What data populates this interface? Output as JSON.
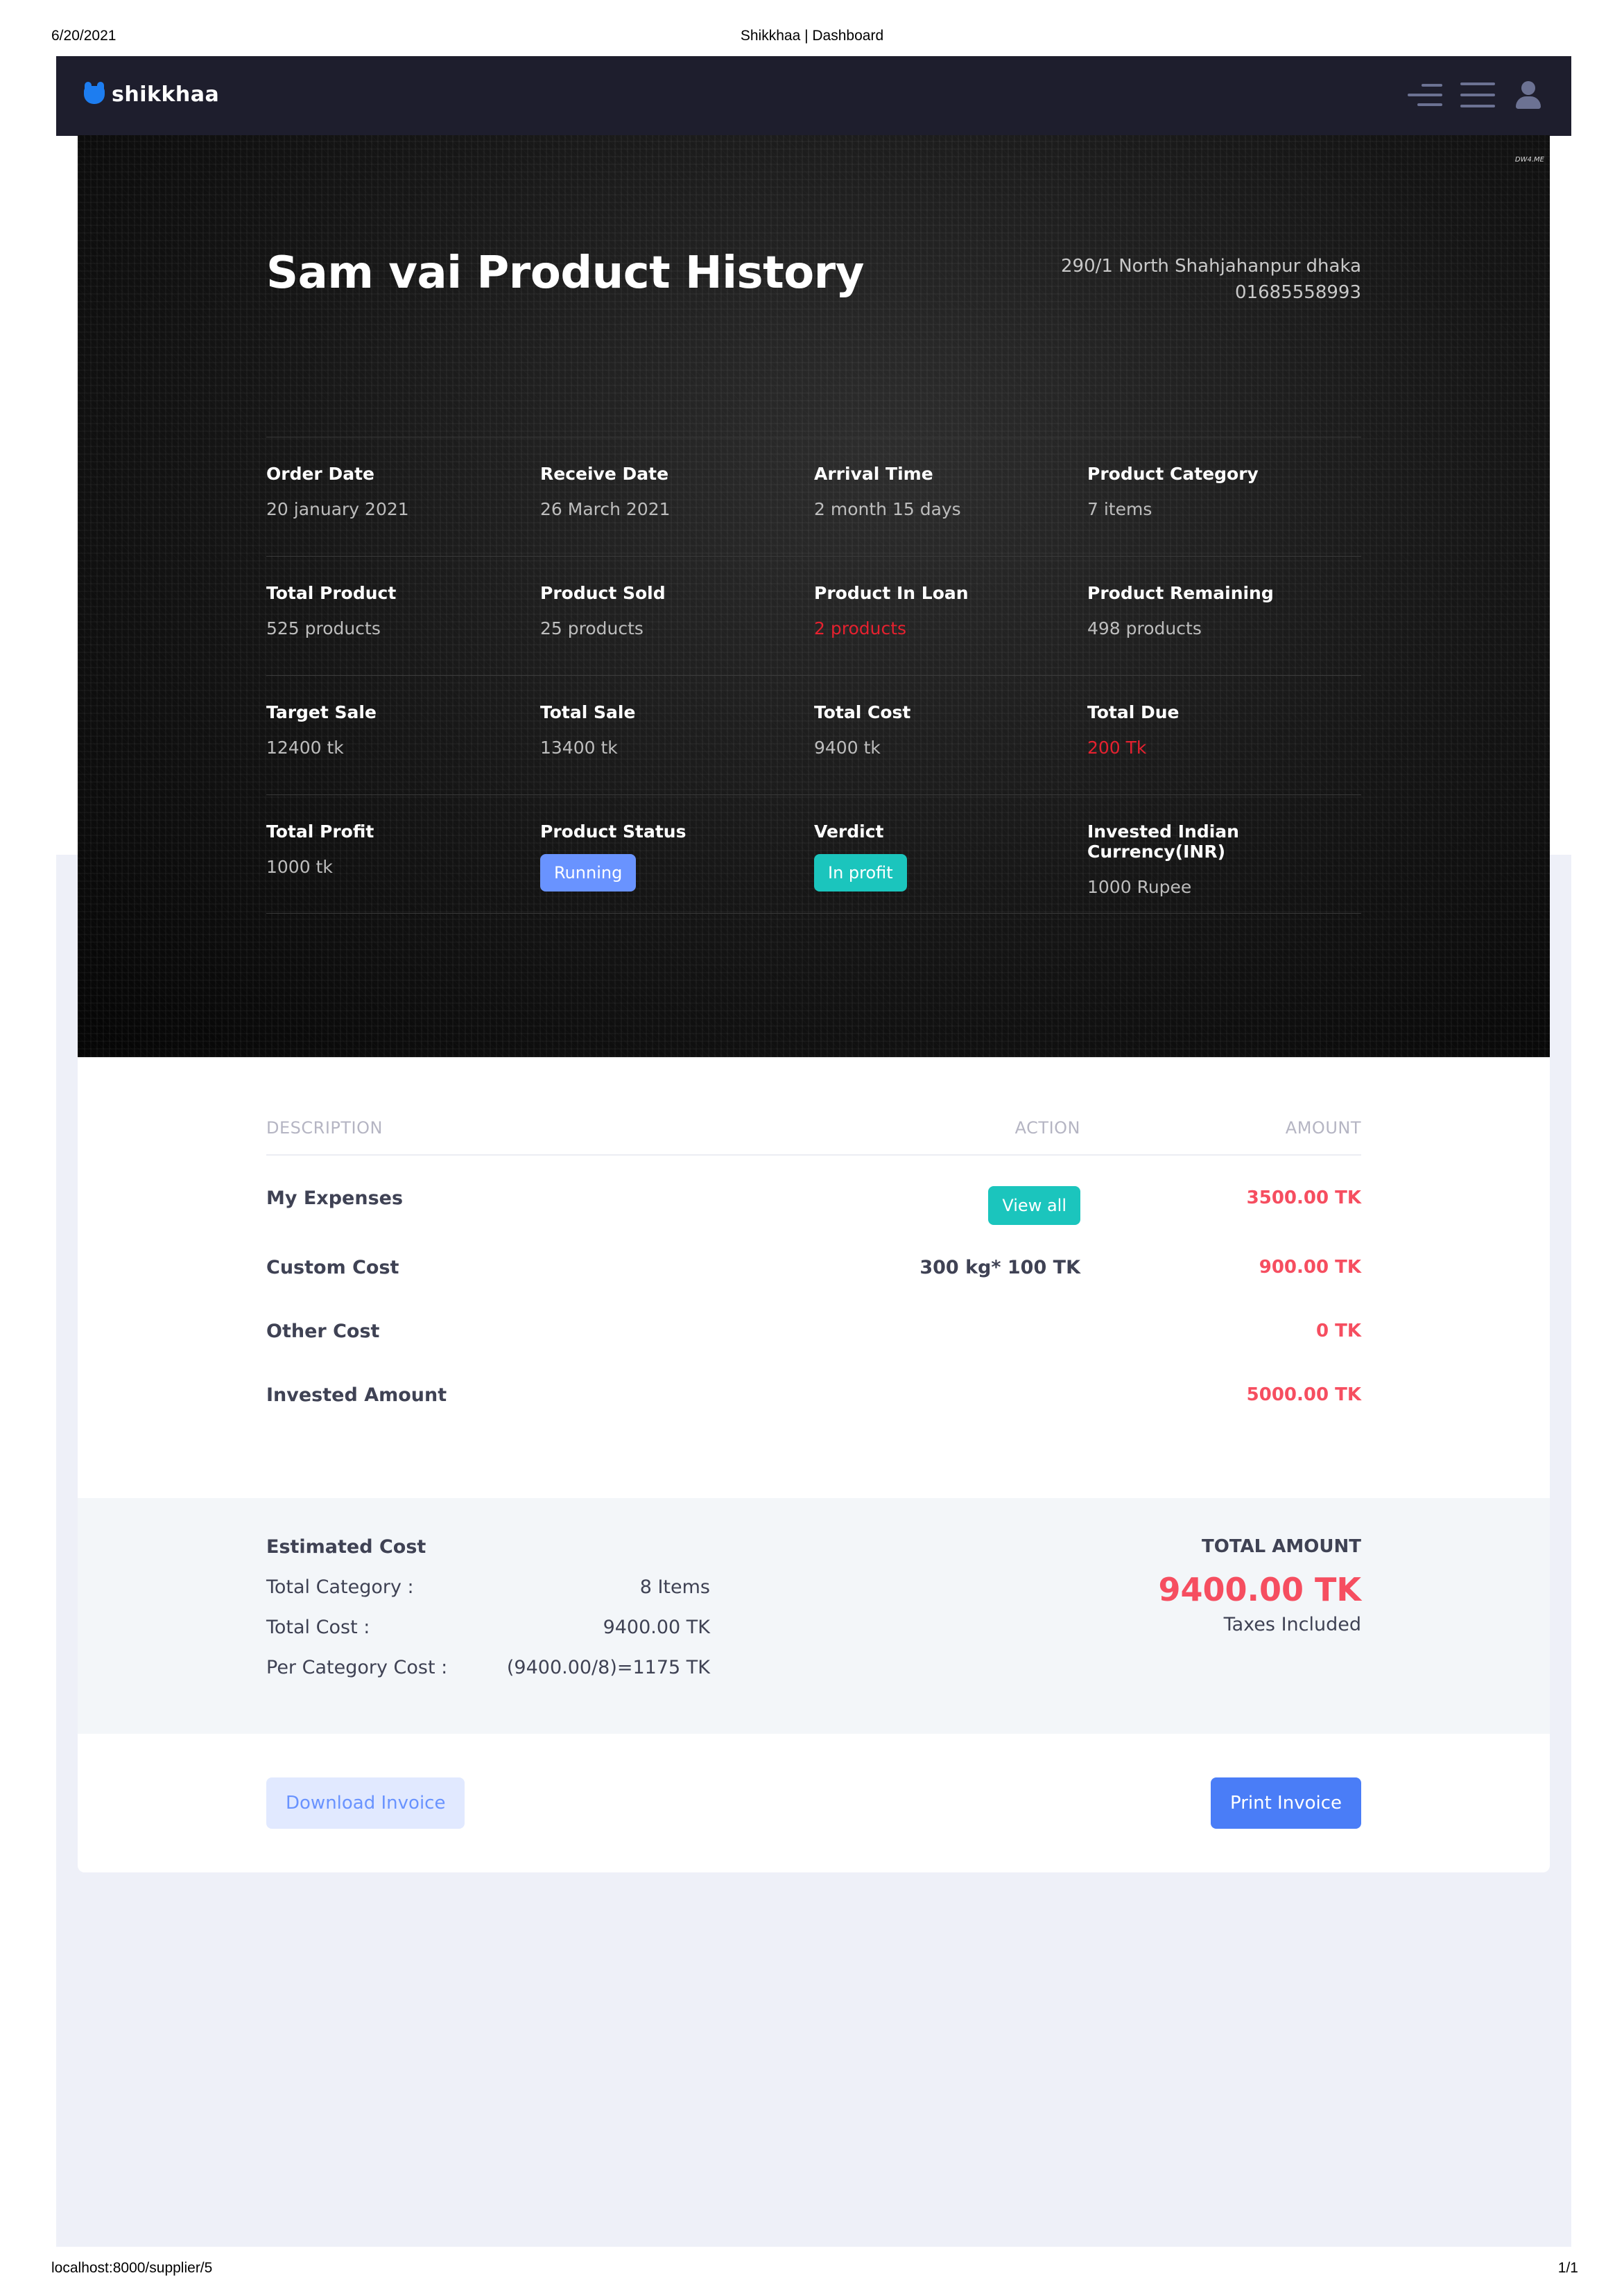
{
  "print": {
    "date": "6/20/2021",
    "title": "Shikkhaa | Dashboard",
    "url": "localhost:8000/supplier/5",
    "page": "1/1"
  },
  "topbar": {
    "brand": "shikkhaa",
    "icons": [
      "menu-lines-icon",
      "menu-icon",
      "user-icon"
    ]
  },
  "hero": {
    "watermark": "DW4.ME",
    "title": "Sam vai Product History",
    "address_line1": "290/1 North Shahjahanpur dhaka",
    "address_line2": "01685558993"
  },
  "info": {
    "rows": [
      [
        {
          "label": "Order Date",
          "value": "20 january 2021"
        },
        {
          "label": "Receive Date",
          "value": "26 March 2021"
        },
        {
          "label": "Arrival Time",
          "value": "2 month 15 days"
        },
        {
          "label": "Product Category",
          "value": "7 items"
        }
      ],
      [
        {
          "label": "Total Product",
          "value": "525 products"
        },
        {
          "label": "Product Sold",
          "value": "25 products"
        },
        {
          "label": "Product In Loan",
          "value": "2 products"
        },
        {
          "label": "Product Remaining",
          "value": "498 products"
        }
      ],
      [
        {
          "label": "Target Sale",
          "value": "12400 tk"
        },
        {
          "label": "Total Sale",
          "value": "13400 tk"
        },
        {
          "label": "Total Cost",
          "value": "9400 tk"
        },
        {
          "label": "Total Due",
          "value": "200 Tk"
        }
      ],
      [
        {
          "label": "Total Profit",
          "value": "1000 tk"
        },
        {
          "label": "Product Status",
          "value": "Running"
        },
        {
          "label": "Verdict",
          "value": "In profit"
        },
        {
          "label": "Invested Indian Currency(INR)",
          "value": "1000 Rupee"
        }
      ]
    ],
    "colors": {
      "danger": "#e5212f",
      "status_badge": "#6993ff",
      "verdict_badge": "#1bc5bd"
    }
  },
  "table": {
    "headers": {
      "description": "DESCRIPTION",
      "action": "ACTION",
      "amount": "AMOUNT"
    },
    "rows": [
      {
        "description": "My Expenses",
        "action": "View all",
        "amount": "3500.00 TK"
      },
      {
        "description": "Custom Cost",
        "action": "300 kg* 100 TK",
        "amount": "900.00 TK"
      },
      {
        "description": "Other Cost",
        "action": "",
        "amount": "0 TK"
      },
      {
        "description": "Invested Amount",
        "action": "",
        "amount": "5000.00 TK"
      }
    ],
    "amount_color": "#f64e60"
  },
  "summary": {
    "heading": "Estimated Cost",
    "lines": [
      {
        "key": "Total Category :",
        "value": "8 Items"
      },
      {
        "key": "Total Cost :",
        "value": "9400.00 TK"
      },
      {
        "key": "Per Category Cost :",
        "value": "(9400.00/8)=1175 TK"
      }
    ],
    "total_label": "TOTAL AMOUNT",
    "total_value": "9400.00 TK",
    "total_note": "Taxes Included"
  },
  "actions": {
    "download": "Download Invoice",
    "print": "Print Invoice"
  }
}
